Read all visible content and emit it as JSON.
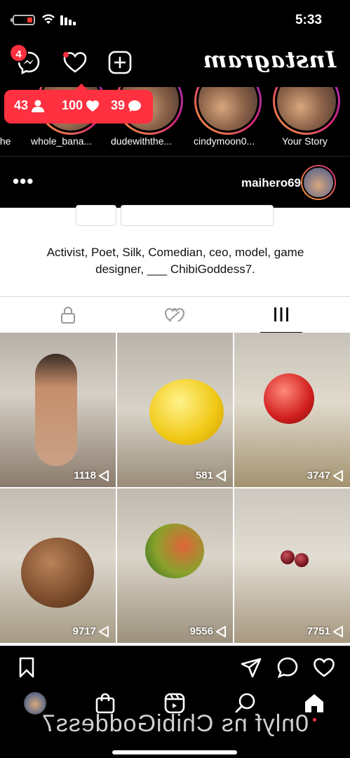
{
  "status": {
    "time": "5:33"
  },
  "header": {
    "logo": "Instagram",
    "dm_badge": "4"
  },
  "notification": {
    "comments": "39",
    "likes": "100",
    "followers": "43"
  },
  "stories": [
    {
      "label": "Your Story"
    },
    {
      "label": "cindymoon0..."
    },
    {
      "label": "dudewiththe..."
    },
    {
      "label": "whole_bana..."
    },
    {
      "label": "the"
    }
  ],
  "account": {
    "username": "maihero69",
    "more": "•••"
  },
  "profile": {
    "bio": "Activist, Poet, Silk, Comedian, ceo, model, game designer, ___ ChibiGoddess7."
  },
  "tabs": [
    "grid",
    "reels",
    "tagged"
  ],
  "grid": [
    {
      "views": "1118",
      "subject": "bikini-mirror-selfie"
    },
    {
      "views": "581",
      "subject": "lemon"
    },
    {
      "views": "3747",
      "subject": "apple"
    },
    {
      "views": "9717",
      "subject": "coconut"
    },
    {
      "views": "9556",
      "subject": "mango"
    },
    {
      "views": "7751",
      "subject": "cherries"
    }
  ],
  "watermark": "0nlyf ns ChibiGoddess7",
  "colors": {
    "accent": "#ff3040",
    "story_ring": "#d62976"
  }
}
